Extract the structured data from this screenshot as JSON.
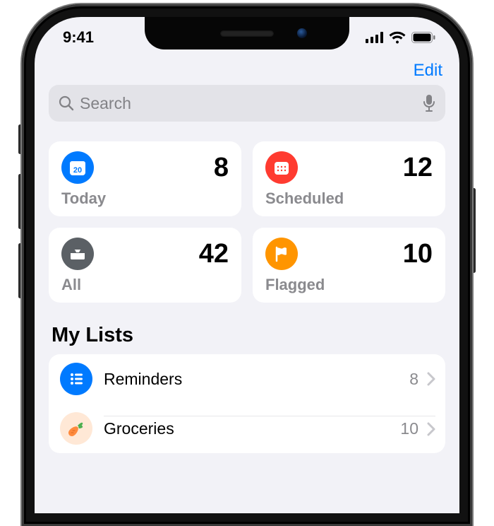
{
  "status": {
    "time": "9:41"
  },
  "nav": {
    "edit": "Edit"
  },
  "search": {
    "placeholder": "Search"
  },
  "smartLists": [
    {
      "id": "today",
      "label": "Today",
      "count": 8,
      "iconName": "calendar-today-icon"
    },
    {
      "id": "scheduled",
      "label": "Scheduled",
      "count": 12,
      "iconName": "calendar-icon"
    },
    {
      "id": "all",
      "label": "All",
      "count": 42,
      "iconName": "tray-icon"
    },
    {
      "id": "flagged",
      "label": "Flagged",
      "count": 10,
      "iconName": "flag-icon"
    }
  ],
  "listsSection": {
    "title": "My Lists"
  },
  "lists": [
    {
      "id": "reminders",
      "title": "Reminders",
      "count": 8,
      "iconName": "list-bullet-icon"
    },
    {
      "id": "groceries",
      "title": "Groceries",
      "count": 10,
      "iconName": "carrot-icon"
    }
  ]
}
